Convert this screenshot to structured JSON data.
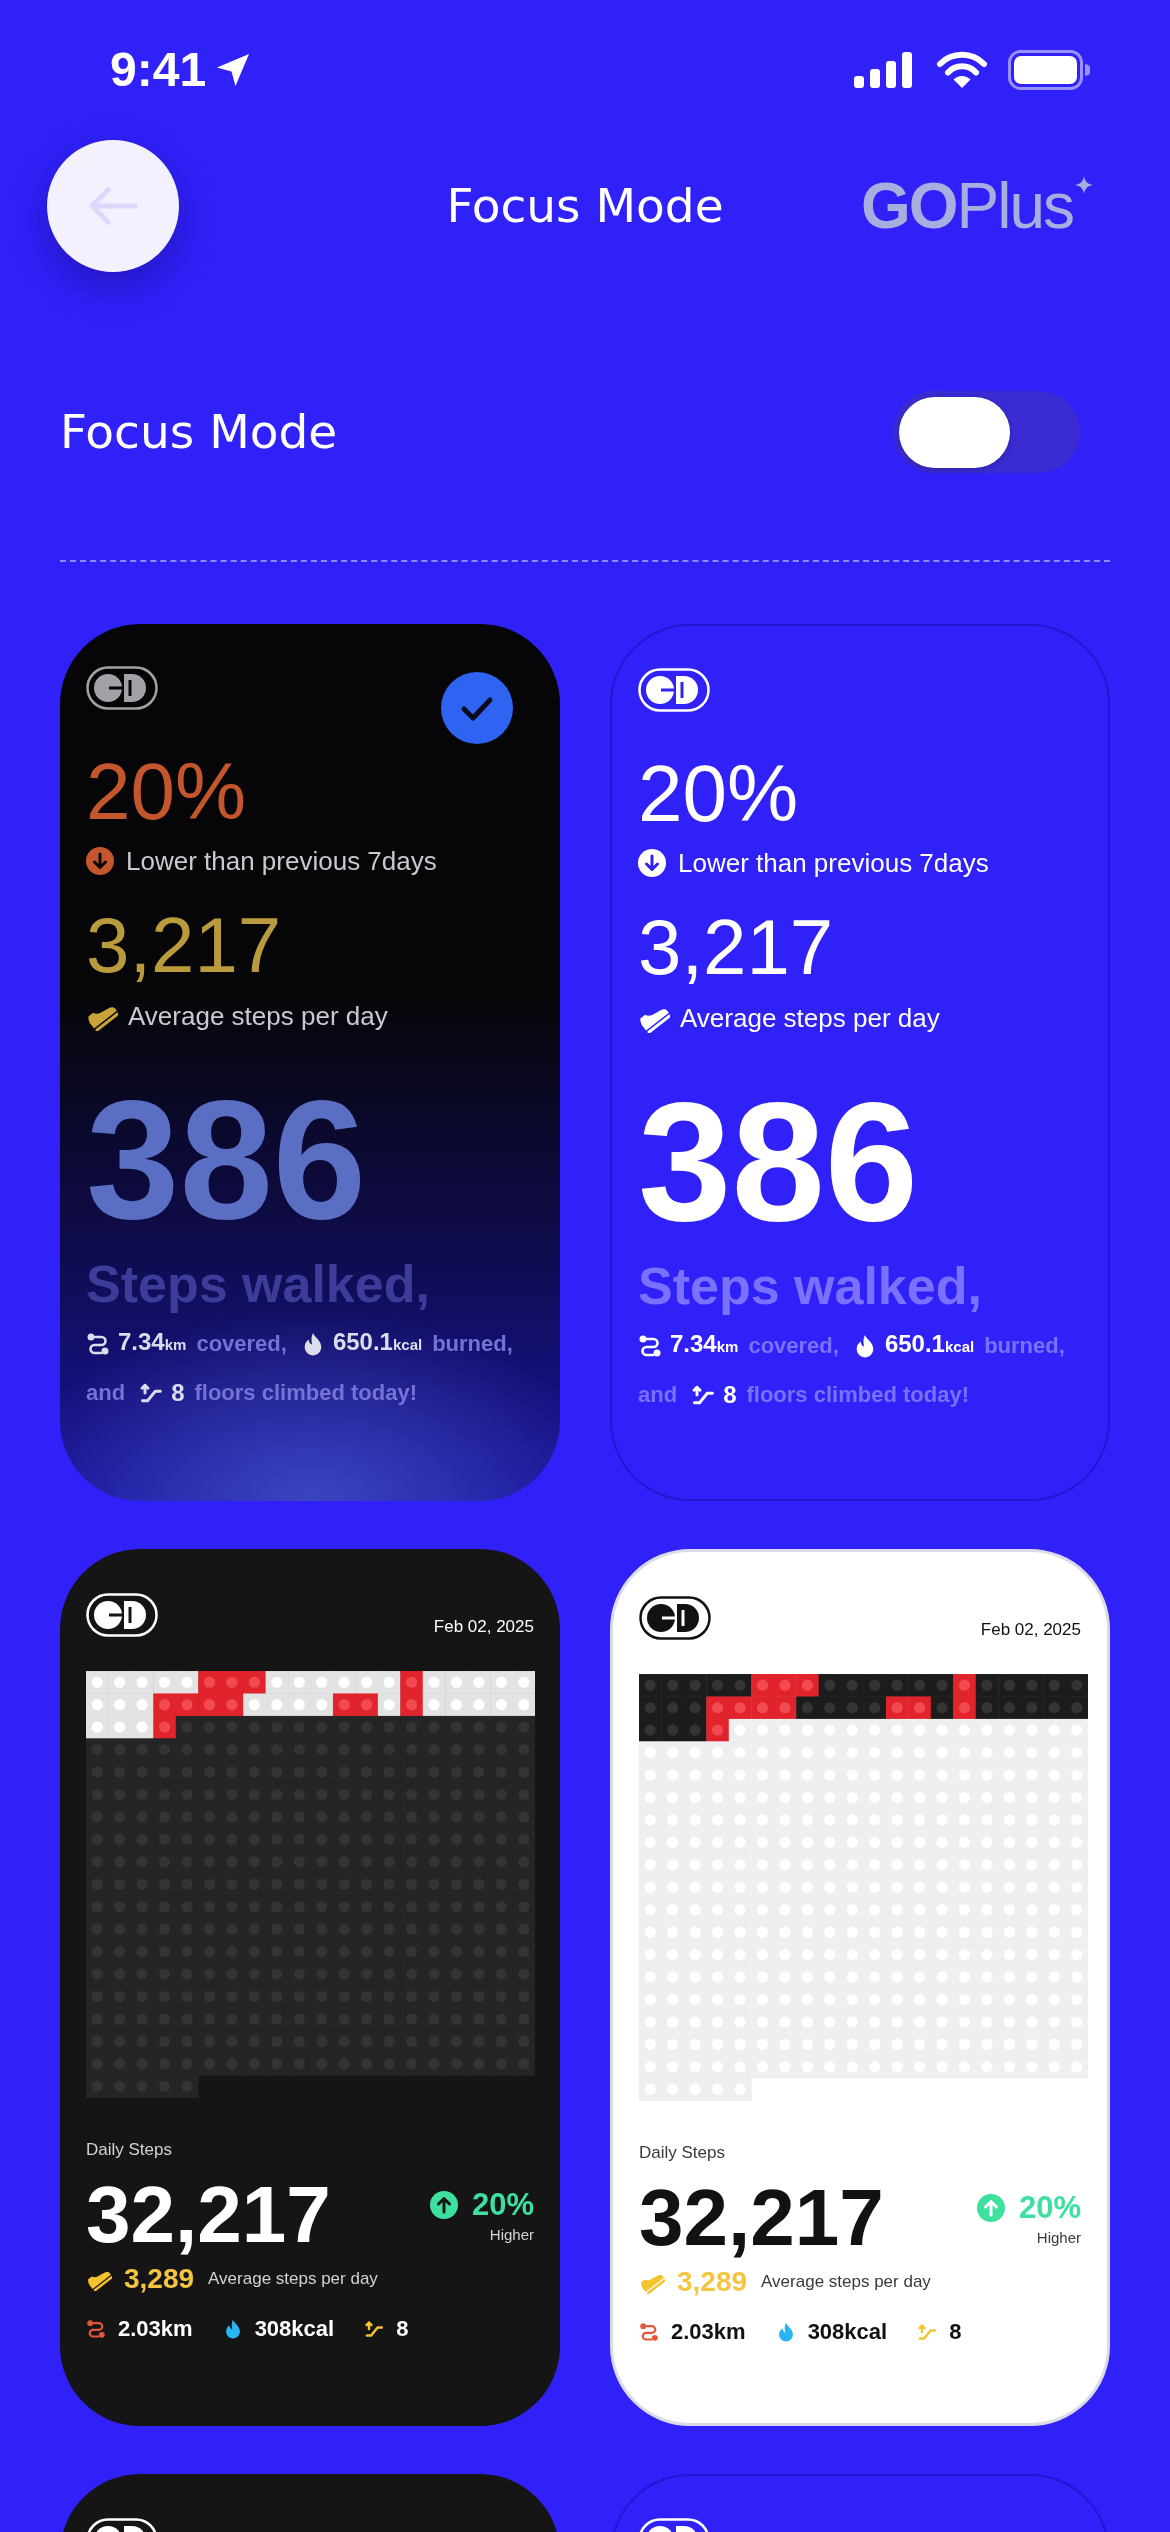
{
  "status_bar": {
    "time": "9:41"
  },
  "header": {
    "title": "Focus Mode",
    "brand": {
      "bold": "GO",
      "light": "Plus"
    }
  },
  "focus_toggle": {
    "label": "Focus Mode",
    "on": false
  },
  "cards": [
    {
      "kind": "summary",
      "selected": true,
      "change": {
        "increase": false,
        "value": "20%",
        "label": "Lower than previous 7days"
      },
      "average": {
        "value": "3,217",
        "label": "Average steps per day"
      },
      "steps": {
        "value": "386",
        "label": "Steps walked,"
      },
      "stats": [
        {
          "kind": "distance",
          "value": "7.34",
          "unit": "km",
          "text": "covered,"
        },
        {
          "kind": "calories",
          "value": "650.1",
          "unit": "kcal",
          "text": "burned,"
        },
        {
          "kind": "floors",
          "prefix": "and",
          "value": "8",
          "text": "floors climbed today!"
        }
      ]
    },
    {
      "kind": "summary",
      "selected": false,
      "change": {
        "increase": false,
        "value": "20%",
        "label": "Lower than previous 7days"
      },
      "average": {
        "value": "3,217",
        "label": "Average steps per day"
      },
      "steps": {
        "value": "386",
        "label": "Steps walked,"
      },
      "stats": [
        {
          "kind": "distance",
          "value": "7.34",
          "unit": "km",
          "text": "covered,"
        },
        {
          "kind": "calories",
          "value": "650.1",
          "unit": "kcal",
          "text": "burned,"
        },
        {
          "kind": "floors",
          "prefix": "and",
          "value": "8",
          "text": "floors climbed today!"
        }
      ]
    },
    {
      "kind": "calendar",
      "selected": false,
      "date": "Feb 02, 2025",
      "title": "Daily Steps",
      "steps": "32,217",
      "change": {
        "increase": true,
        "value": "20%",
        "label": "Higher"
      },
      "average": {
        "value": "3,289",
        "label": "Average steps per day"
      },
      "stats": [
        {
          "kind": "distance",
          "value": "2.03km"
        },
        {
          "kind": "calories",
          "value": "308kcal"
        },
        {
          "kind": "floors",
          "value": "8"
        }
      ]
    },
    {
      "kind": "calendar",
      "selected": false,
      "date": "Feb 02, 2025",
      "title": "Daily Steps",
      "steps": "32,217",
      "change": {
        "increase": true,
        "value": "20%",
        "label": "Higher"
      },
      "average": {
        "value": "3,289",
        "label": "Average steps per day"
      },
      "stats": [
        {
          "kind": "distance",
          "value": "2.03km"
        },
        {
          "kind": "calories",
          "value": "308kcal"
        },
        {
          "kind": "floors",
          "value": "8"
        }
      ]
    },
    {
      "selected": false
    },
    {
      "selected": false
    }
  ]
}
